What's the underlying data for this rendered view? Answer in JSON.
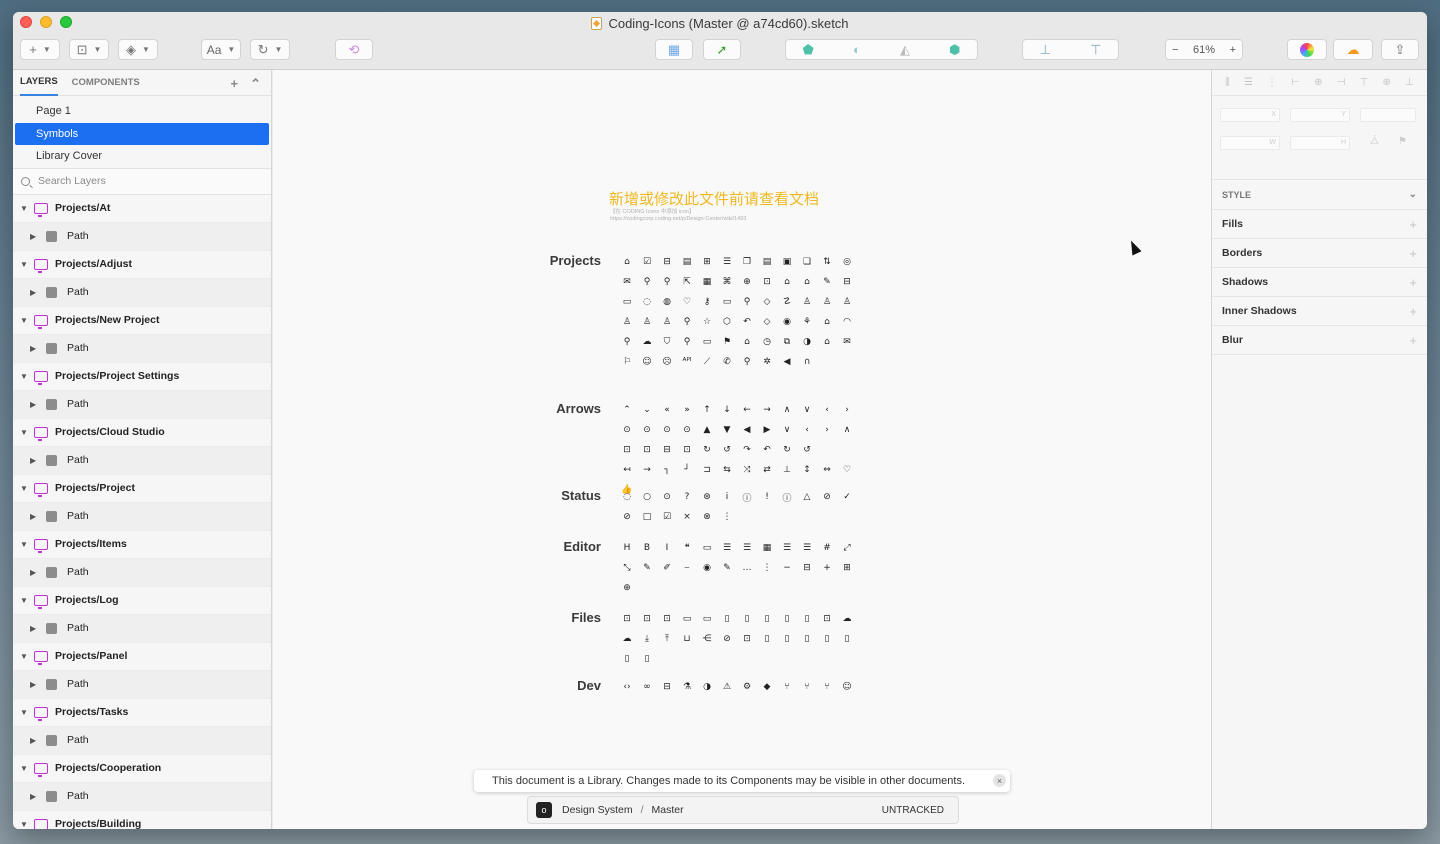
{
  "window": {
    "title": "Coding-Icons (Master @ a74cd60).sketch"
  },
  "toolbar": {
    "insert_glyph": "+",
    "text_label": "Aa",
    "zoom_minus": "−",
    "zoom_value": "61%",
    "zoom_plus": "+"
  },
  "sidebar": {
    "tabs": [
      "LAYERS",
      "COMPONENTS"
    ],
    "pages": [
      "Page 1",
      "Symbols",
      "Library Cover"
    ],
    "search_placeholder": "Search Layers",
    "layers": [
      {
        "name": "Projects/At",
        "child": "Path"
      },
      {
        "name": "Projects/Adjust",
        "child": "Path"
      },
      {
        "name": "Projects/New Project",
        "child": "Path"
      },
      {
        "name": "Projects/Project Settings",
        "child": "Path"
      },
      {
        "name": "Projects/Cloud Studio",
        "child": "Path"
      },
      {
        "name": "Projects/Project",
        "child": "Path"
      },
      {
        "name": "Projects/Items",
        "child": "Path"
      },
      {
        "name": "Projects/Log",
        "child": "Path"
      },
      {
        "name": "Projects/Panel",
        "child": "Path"
      },
      {
        "name": "Projects/Tasks",
        "child": "Path"
      },
      {
        "name": "Projects/Cooperation",
        "child": "Path"
      },
      {
        "name": "Projects/Building",
        "child": ""
      }
    ]
  },
  "canvas": {
    "heading": "新增或修改此文件前请查看文档",
    "subline1": "【在 CODING Icons 中添加 icon】",
    "subline2": "https://codingcorp.coding.net/p/Design-Center/wiki/1493",
    "sections": [
      {
        "label": "Projects",
        "icons": [
          "⌂",
          "☑",
          "⊟",
          "▤",
          "⊞",
          "☰",
          "❐",
          "▤",
          "▣",
          "❏",
          "⇅",
          "◎",
          "✉",
          "⚲",
          "⚲",
          "⇱",
          "▦",
          "⌘",
          "⊕",
          "⊡",
          "⌂",
          "⌂",
          "✎",
          "⊟",
          "▭",
          "◌",
          "◍",
          "♡",
          "⚷",
          "▭",
          "⚲",
          "◇",
          "☡",
          "♙",
          "♙",
          "♙",
          "♙",
          "♙",
          "♙",
          "⚲",
          "☆",
          "⬡",
          "↶",
          "◇",
          "◉",
          "⚘",
          "⌂",
          "◠",
          "⚲",
          "☁",
          "⛉",
          "⚲",
          "▭",
          "⚑",
          "⌂",
          "◷",
          "⧉",
          "◑",
          "⌂",
          "✉",
          "⚐",
          "☺",
          "☹",
          "ᴬᴾᴵ",
          "⟋",
          "✆",
          "⚲",
          "✲",
          "◀",
          "∩"
        ]
      },
      {
        "label": "Arrows",
        "icons": [
          "⌃",
          "⌄",
          "«",
          "»",
          "↑",
          "↓",
          "←",
          "→",
          "∧",
          "∨",
          "‹",
          "›",
          "⊙",
          "⊙",
          "⊙",
          "⊙",
          "▲",
          "▼",
          "◀",
          "▶",
          "∨",
          "‹",
          "›",
          "∧",
          "⊡",
          "⊡",
          "⊟",
          "⊡",
          "↻",
          "↺",
          "↷",
          "↶",
          "↻",
          "↺",
          "",
          "",
          "↤",
          "→",
          "┐",
          "┘",
          "⊐",
          "⇆",
          "⤨",
          "⇄",
          "⊥",
          "↕",
          "⇔",
          "♡",
          "👍"
        ]
      },
      {
        "label": "Status",
        "icons": [
          "◌",
          "○",
          "⊙",
          "?",
          "⊛",
          "i",
          "ⓘ",
          "!",
          "ⓘ",
          "△",
          "⊘",
          "✓",
          "⊘",
          "□",
          "☑",
          "×",
          "⊗",
          "⋮"
        ]
      },
      {
        "label": "Editor",
        "icons": [
          "H",
          "B",
          "I",
          "❝",
          "▭",
          "☰",
          "☰",
          "▦",
          "☰",
          "☰",
          "#",
          "⤢",
          "⤡",
          "✎",
          "✐",
          "⌣",
          "◉",
          "✎",
          "…",
          "⋮",
          "−",
          "⊟",
          "+",
          "⊞",
          "⊕"
        ]
      },
      {
        "label": "Files",
        "icons": [
          "⊡",
          "⊡",
          "⊡",
          "▭",
          "▭",
          "▯",
          "▯",
          "▯",
          "▯",
          "▯",
          "⊡",
          "☁",
          "☁",
          "⤓",
          "⤒",
          "⊔",
          "⋲",
          "⊘",
          "⊡",
          "▯",
          "▯",
          "▯",
          "▯",
          "▯",
          "▯",
          "▯"
        ]
      },
      {
        "label": "Dev",
        "icons": [
          "‹›",
          "∞",
          "⊟",
          "⚗",
          "◑",
          "⚠",
          "⚙",
          "◆",
          "⑂",
          "⑂",
          "⑂",
          "☺"
        ]
      }
    ],
    "banner_text": "This document is a Library. Changes made to its Components may be visible in other documents.",
    "banner_close": "×",
    "vc": {
      "logo": "o",
      "project": "Design System",
      "separator": "/",
      "branch": "Master",
      "status": "UNTRACKED"
    }
  },
  "inspector": {
    "geo_labels": [
      "X",
      "Y",
      "",
      "W",
      "H"
    ],
    "style_heading": "STYLE",
    "style_rows": [
      "Fills",
      "Borders",
      "Shadows",
      "Inner Shadows",
      "Blur"
    ]
  }
}
